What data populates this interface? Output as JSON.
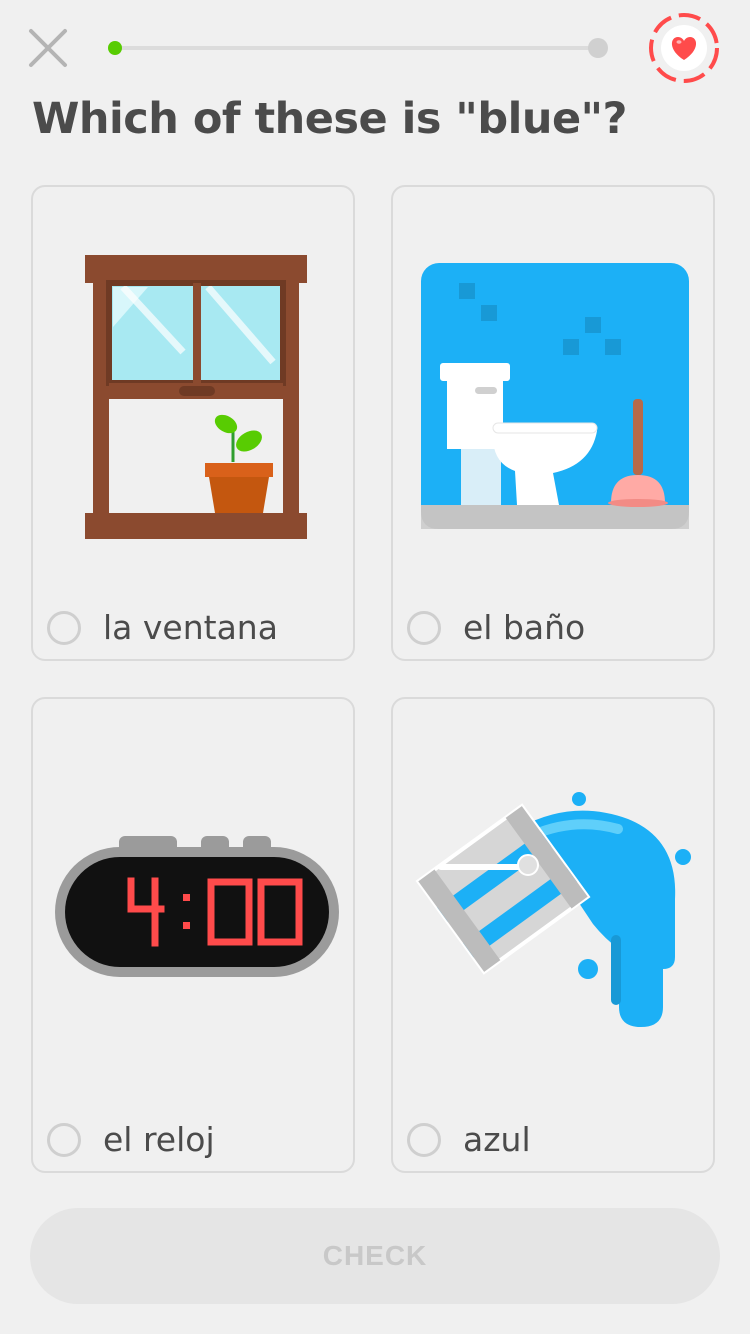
{
  "header": {
    "close_icon": "close-icon",
    "progress": 0.0,
    "hearts_icon": "heart-icon"
  },
  "question": "Which of these is \"blue\"?",
  "options": [
    {
      "label": "la ventana",
      "image": "window-plant-illustration"
    },
    {
      "label": "el baño",
      "image": "bathroom-toilet-illustration"
    },
    {
      "label": "el reloj",
      "image": "alarm-clock-illustration",
      "clock_text": "4:00"
    },
    {
      "label": "azul",
      "image": "paint-bucket-spill-illustration"
    }
  ],
  "check_button": {
    "label": "CHECK",
    "enabled": false
  },
  "colors": {
    "background": "#f0f0f0",
    "progress_active": "#58cc02",
    "heart": "#ff4b4b",
    "text": "#4b4b4b",
    "blue": "#1cb0f6"
  }
}
